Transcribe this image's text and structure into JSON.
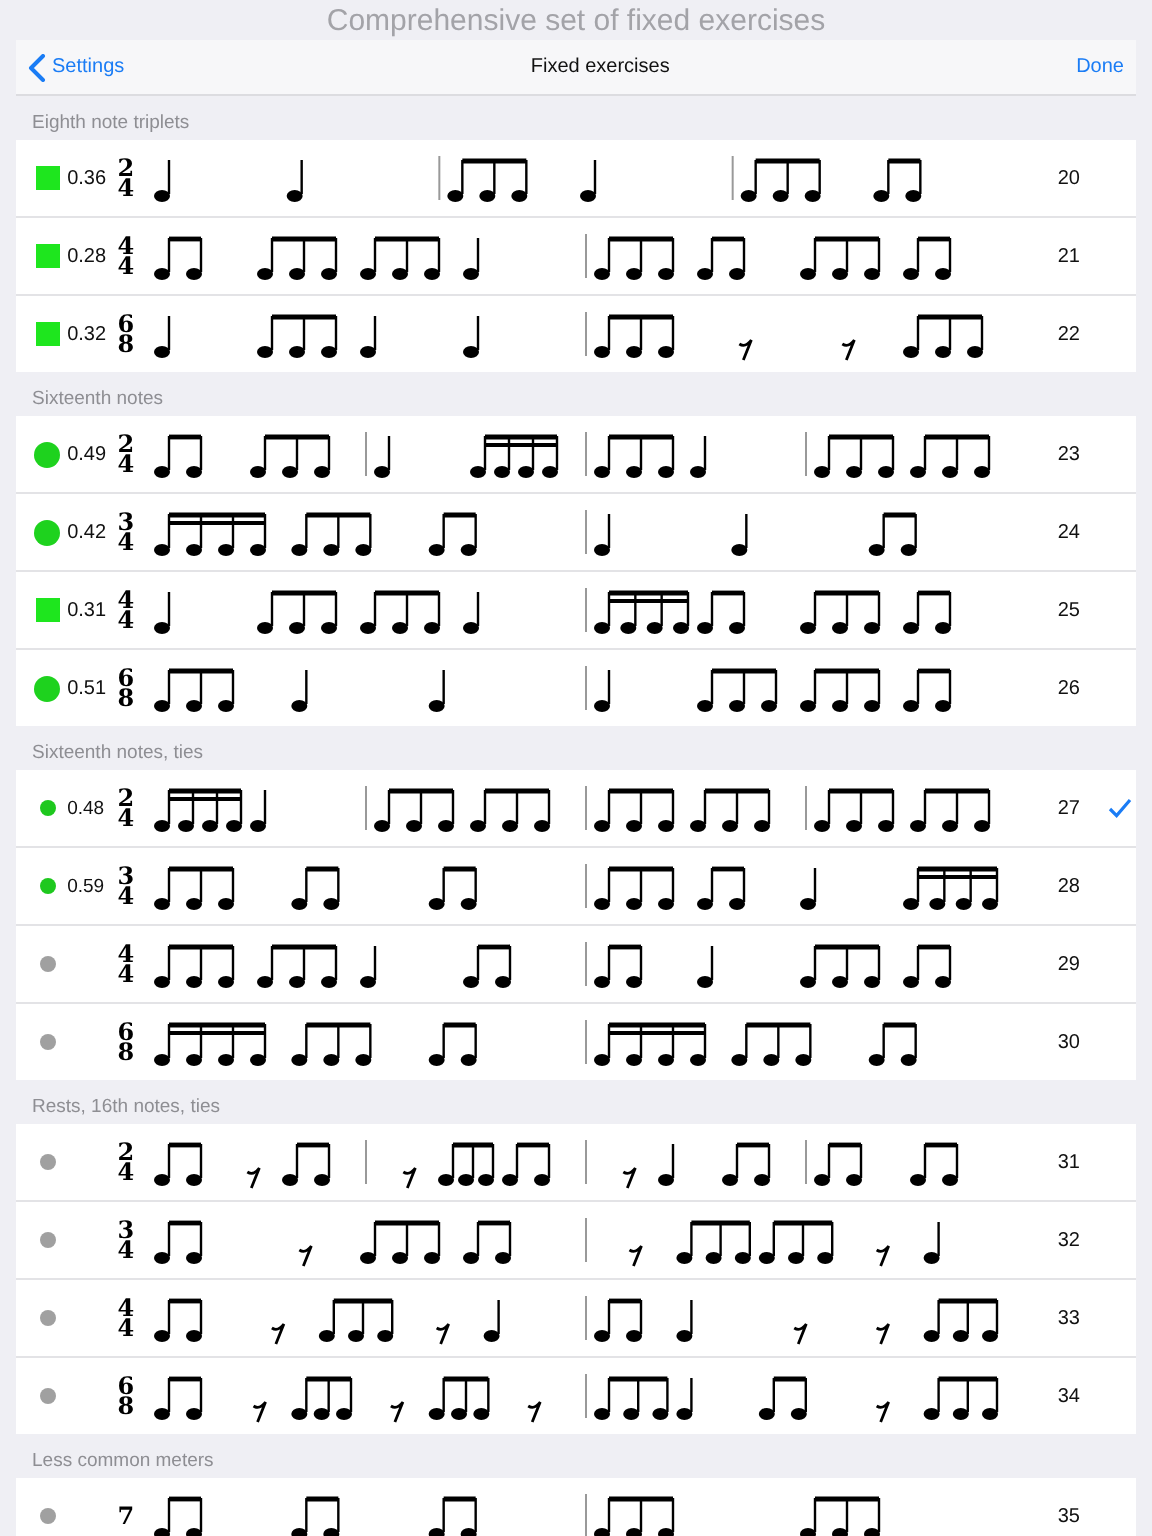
{
  "header": {
    "title": "Comprehensive set of fixed exercises"
  },
  "nav_bar": {
    "back": "Settings",
    "title": "Fixed exercises",
    "done": "Done"
  },
  "sections": [
    {
      "title": "Eighth note triplets",
      "rows": [
        {
          "marker": {
            "kind": "square",
            "color": "#1ee61e"
          },
          "score": "0.36",
          "time_signature": [
            "2",
            "4"
          ],
          "number": "20",
          "selected": false
        },
        {
          "marker": {
            "kind": "square",
            "color": "#1ee61e"
          },
          "score": "0.28",
          "time_signature": [
            "4",
            "4"
          ],
          "number": "21",
          "selected": false
        },
        {
          "marker": {
            "kind": "square",
            "color": "#1ee61e"
          },
          "score": "0.32",
          "time_signature": [
            "6",
            "8"
          ],
          "number": "22",
          "selected": false
        }
      ]
    },
    {
      "title": "Sixteenth notes",
      "rows": [
        {
          "marker": {
            "kind": "circle",
            "color": "#1ed21e"
          },
          "score": "0.49",
          "time_signature": [
            "2",
            "4"
          ],
          "number": "23",
          "selected": false
        },
        {
          "marker": {
            "kind": "circle",
            "color": "#1ed21e"
          },
          "score": "0.42",
          "time_signature": [
            "3",
            "4"
          ],
          "number": "24",
          "selected": false
        },
        {
          "marker": {
            "kind": "square",
            "color": "#1ee61e"
          },
          "score": "0.31",
          "time_signature": [
            "4",
            "4"
          ],
          "number": "25",
          "selected": false
        },
        {
          "marker": {
            "kind": "circle",
            "color": "#1ed21e"
          },
          "score": "0.51",
          "time_signature": [
            "6",
            "8"
          ],
          "number": "26",
          "selected": false
        }
      ]
    },
    {
      "title": "Sixteenth notes, ties",
      "rows": [
        {
          "marker": {
            "kind": "dot",
            "color": "#1ec81e"
          },
          "score": "0.48",
          "time_signature": [
            "2",
            "4"
          ],
          "number": "27",
          "selected": true
        },
        {
          "marker": {
            "kind": "dot",
            "color": "#1ec81e"
          },
          "score": "0.59",
          "time_signature": [
            "3",
            "4"
          ],
          "number": "28",
          "selected": false
        },
        {
          "marker": {
            "kind": "dot",
            "color": "#a0a0a0"
          },
          "time_signature": [
            "4",
            "4"
          ],
          "number": "29",
          "selected": false
        },
        {
          "marker": {
            "kind": "dot",
            "color": "#a0a0a0"
          },
          "time_signature": [
            "6",
            "8"
          ],
          "number": "30",
          "selected": false
        }
      ]
    },
    {
      "title": "Rests, 16th notes, ties",
      "rows": [
        {
          "marker": {
            "kind": "dot",
            "color": "#a0a0a0"
          },
          "time_signature": [
            "2",
            "4"
          ],
          "number": "31",
          "selected": false
        },
        {
          "marker": {
            "kind": "dot",
            "color": "#a0a0a0"
          },
          "time_signature": [
            "3",
            "4"
          ],
          "number": "32",
          "selected": false
        },
        {
          "marker": {
            "kind": "dot",
            "color": "#a0a0a0"
          },
          "time_signature": [
            "4",
            "4"
          ],
          "number": "33",
          "selected": false
        },
        {
          "marker": {
            "kind": "dot",
            "color": "#a0a0a0"
          },
          "time_signature": [
            "6",
            "8"
          ],
          "number": "34",
          "selected": false
        }
      ]
    },
    {
      "title": "Less common meters",
      "rows": [
        {
          "marker": {
            "kind": "dot",
            "color": "#a0a0a0"
          },
          "time_signature": [
            "7"
          ],
          "number": "35",
          "selected": false
        }
      ]
    }
  ]
}
